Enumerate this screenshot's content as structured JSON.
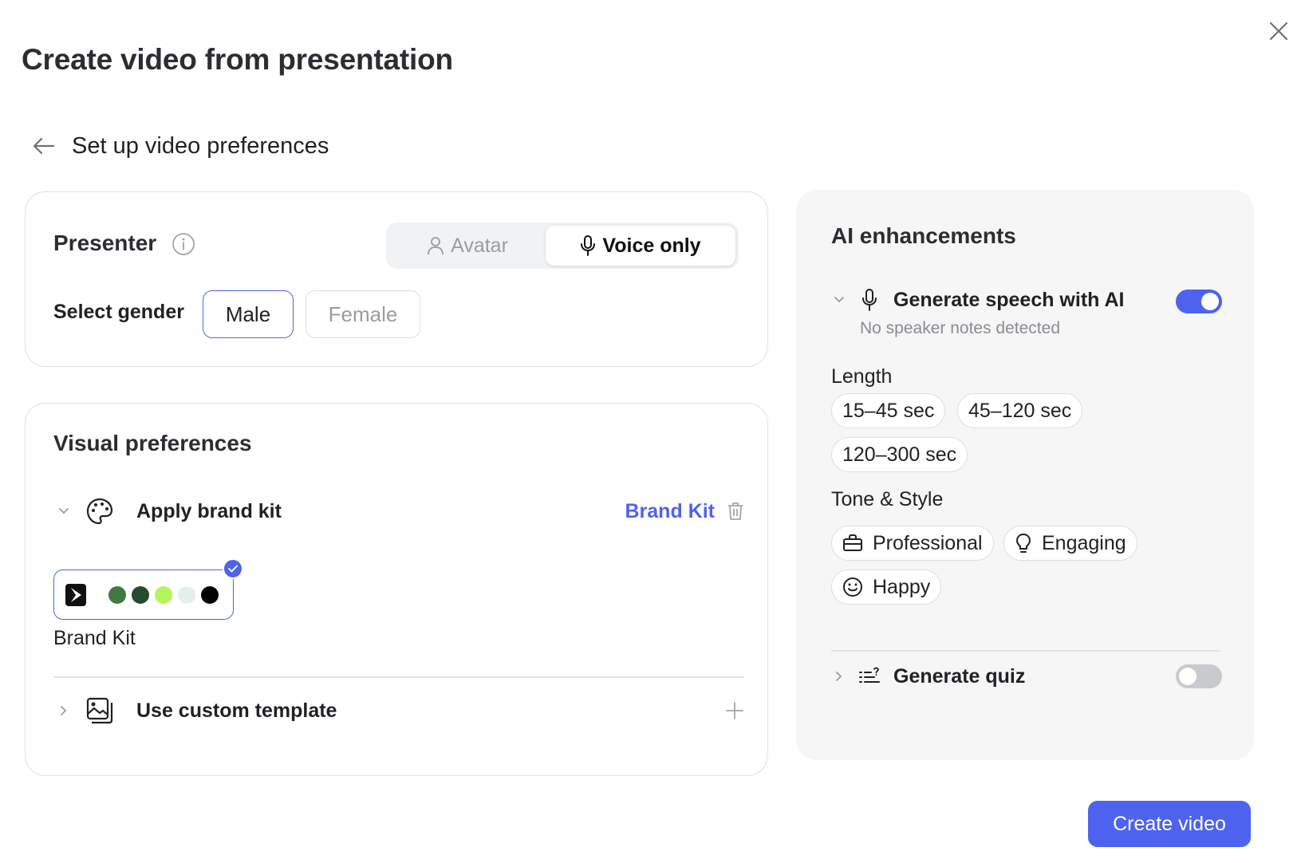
{
  "dialog": {
    "title": "Create video from presentation",
    "close_icon": "close-icon",
    "back_icon": "arrow-left-icon",
    "step_title": "Set up video preferences"
  },
  "presenter": {
    "title": "Presenter",
    "info_icon": "info-icon",
    "modes": [
      {
        "label": "Avatar",
        "icon": "person-icon",
        "selected": false
      },
      {
        "label": "Voice only",
        "icon": "microphone-icon",
        "selected": true
      }
    ],
    "gender_label": "Select gender",
    "genders": [
      {
        "label": "Male",
        "selected": true
      },
      {
        "label": "Female",
        "selected": false
      }
    ]
  },
  "visual": {
    "title": "Visual preferences",
    "brand_kit_row": {
      "label": "Apply brand kit",
      "link": "Brand Kit",
      "icon": "palette-icon",
      "delete_icon": "trash-icon",
      "expanded": true
    },
    "kit": {
      "name": "Brand Kit",
      "selected": true,
      "colors": [
        "#3f7a41",
        "#254a31",
        "#b3f55c",
        "#e6eee9",
        "#000000"
      ]
    },
    "template_row": {
      "label": "Use custom template",
      "icon": "image-template-icon",
      "add_icon": "plus-icon",
      "expanded": false
    }
  },
  "ai": {
    "title": "AI enhancements",
    "speech": {
      "label": "Generate speech with AI",
      "subtitle": "No speaker notes detected",
      "icon": "microphone-icon",
      "enabled": true
    },
    "length_label": "Length",
    "lengths": [
      "15–45 sec",
      "45–120 sec",
      "120–300 sec"
    ],
    "tone_label": "Tone & Style",
    "tones": [
      {
        "label": "Professional",
        "icon": "briefcase-icon"
      },
      {
        "label": "Engaging",
        "icon": "lightbulb-icon"
      },
      {
        "label": "Happy",
        "icon": "smiley-icon"
      }
    ],
    "quiz": {
      "label": "Generate quiz",
      "icon": "quiz-list-icon",
      "enabled": false
    }
  },
  "actions": {
    "create_label": "Create video"
  },
  "colors": {
    "accent": "#4d63ef",
    "panel_bg": "#f6f6f7",
    "border": "#dfe1e5"
  }
}
